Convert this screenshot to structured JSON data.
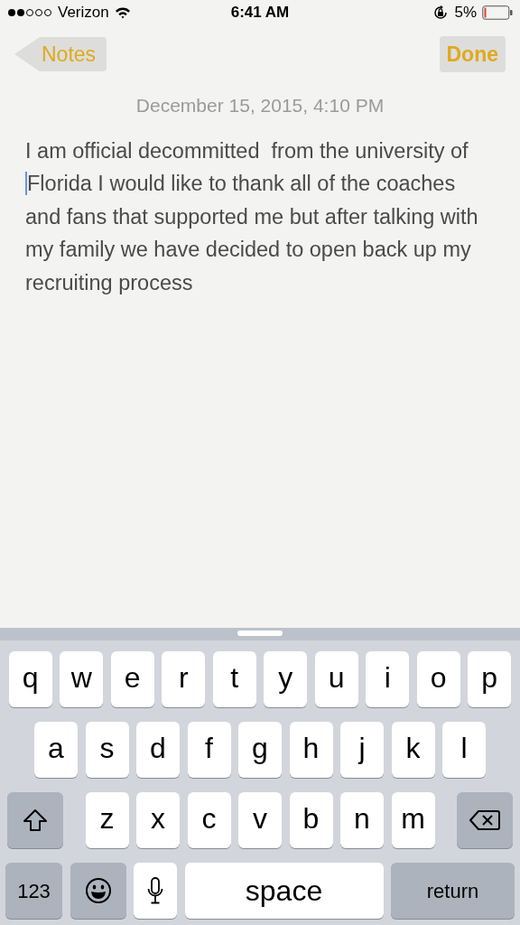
{
  "status_bar": {
    "carrier": "Verizon",
    "time": "6:41 AM",
    "battery": "5%"
  },
  "nav": {
    "back": "Notes",
    "done": "Done"
  },
  "note": {
    "date": "December 15, 2015, 4:10 PM",
    "body_before_cursor": "I am official decommitted  from the university of ",
    "body_after_cursor": "Florida I would like to thank all of the coaches and fans that supported me but after talking with my family we have decided to open back up my recruiting process"
  },
  "keyboard": {
    "rows": [
      [
        "q",
        "w",
        "e",
        "r",
        "t",
        "y",
        "u",
        "i",
        "o",
        "p"
      ],
      [
        "a",
        "s",
        "d",
        "f",
        "g",
        "h",
        "j",
        "k",
        "l"
      ],
      [
        "z",
        "x",
        "c",
        "v",
        "b",
        "n",
        "m"
      ]
    ],
    "bottom_row": [
      {
        "kind": "numbers",
        "label": "123"
      },
      {
        "kind": "emoji"
      },
      {
        "kind": "mic"
      },
      {
        "kind": "space",
        "label": "space"
      },
      {
        "kind": "return",
        "label": "return"
      }
    ]
  }
}
